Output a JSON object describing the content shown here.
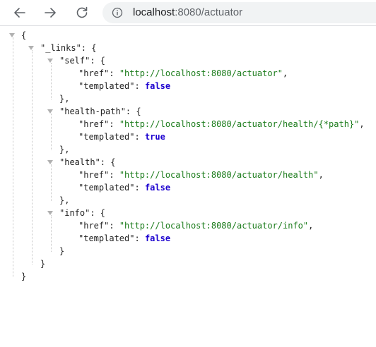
{
  "browser": {
    "url_host": "localhost",
    "url_rest": ":8080/actuator",
    "icons": {
      "back": "back-arrow-icon",
      "forward": "forward-arrow-icon",
      "reload": "reload-icon",
      "site_info": "info-circle-icon"
    }
  },
  "json": {
    "links_key": "\"_links\"",
    "entries": [
      {
        "key": "\"self\"",
        "href": "\"http://localhost:8080/actuator\"",
        "href_comma": ",",
        "templated": "false",
        "close": "},"
      },
      {
        "key": "\"health-path\"",
        "href": "\"http://localhost:8080/actuator/health/{*path}\"",
        "href_comma": ",",
        "templated": "true",
        "close": "},"
      },
      {
        "key": "\"health\"",
        "href": "\"http://localhost:8080/actuator/health\"",
        "href_comma": ",",
        "templated": "false",
        "close": "},"
      },
      {
        "key": "\"info\"",
        "href": "\"http://localhost:8080/actuator/info\"",
        "href_comma": ",",
        "templated": "false",
        "close": "}"
      }
    ],
    "labels": {
      "href_key": "\"href\"",
      "templated_key": "\"templated\""
    },
    "colors": {
      "string": "#1a7b1a",
      "boolean": "#1c00cf",
      "punctuation": "#222222"
    }
  }
}
